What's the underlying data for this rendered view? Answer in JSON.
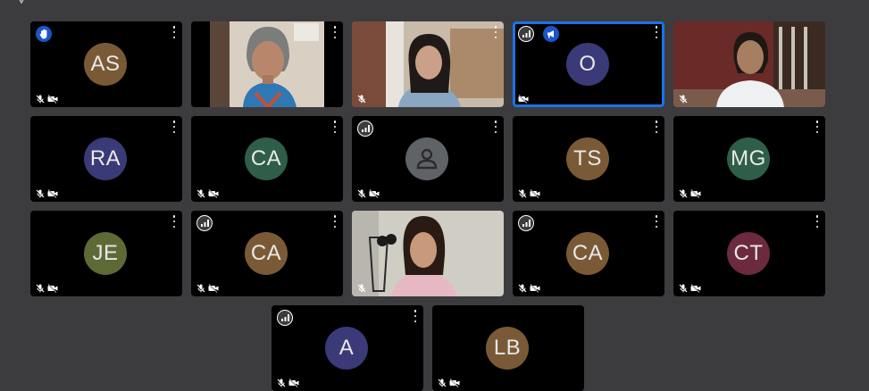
{
  "participants": [
    {
      "initials": "AS",
      "color": "#7a5a36",
      "video": false,
      "hand_raised": true
    },
    {
      "initials": "",
      "video": true,
      "scene": "older-woman-blue-top"
    },
    {
      "initials": "",
      "video": true,
      "scene": "young-woman-room"
    },
    {
      "initials": "O",
      "color": "#3b3a78",
      "video": false,
      "active_speaker": true,
      "presenting_icon": true
    },
    {
      "initials": "",
      "video": true,
      "scene": "woman-white-coat"
    },
    {
      "initials": "RA",
      "color": "#3b3a78",
      "video": false
    },
    {
      "initials": "CA",
      "color": "#2e5e48",
      "video": false
    },
    {
      "initials": "",
      "color": "#5f6368",
      "video": false,
      "generic_avatar": true
    },
    {
      "initials": "TS",
      "color": "#7a5a36",
      "video": false
    },
    {
      "initials": "MG",
      "color": "#2e5e48",
      "video": false
    },
    {
      "initials": "JE",
      "color": "#5d6a36",
      "video": false
    },
    {
      "initials": "CA",
      "color": "#7a5a36",
      "video": false
    },
    {
      "initials": "",
      "video": true,
      "scene": "woman-pink-top"
    },
    {
      "initials": "CA",
      "color": "#7a5a36",
      "video": false
    },
    {
      "initials": "CT",
      "color": "#6b2a3e",
      "video": false
    },
    {
      "initials": "A",
      "color": "#3b3a78",
      "video": false
    },
    {
      "initials": "LB",
      "color": "#7a5a36",
      "video": false
    }
  ],
  "icons": {
    "more": "more-vert-icon",
    "mic_off": "mic-off-icon",
    "camera_off": "camera-off-icon",
    "signal": "signal-icon",
    "hand": "hand-raised-icon",
    "presenting": "presenting-icon"
  }
}
